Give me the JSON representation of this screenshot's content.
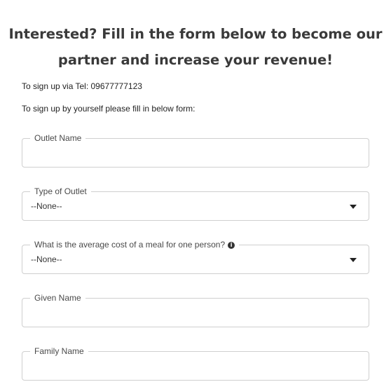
{
  "heading": {
    "line1": "Interested? Fill in the form below to become our",
    "line2": "partner and increase your revenue!"
  },
  "notes": {
    "tel": "To sign up via Tel: 09677777123",
    "self": "To sign up by yourself please fill in below form:"
  },
  "form": {
    "outlet_name": {
      "label": "Outlet Name",
      "value": ""
    },
    "type_of_outlet": {
      "label": "Type of Outlet",
      "selected": "--None--"
    },
    "average_cost": {
      "label": "What is the average cost of a meal for one person?",
      "selected": "--None--",
      "info_icon": "info-icon"
    },
    "given_name": {
      "label": "Given Name",
      "value": ""
    },
    "family_name": {
      "label": "Family Name",
      "value": ""
    }
  }
}
